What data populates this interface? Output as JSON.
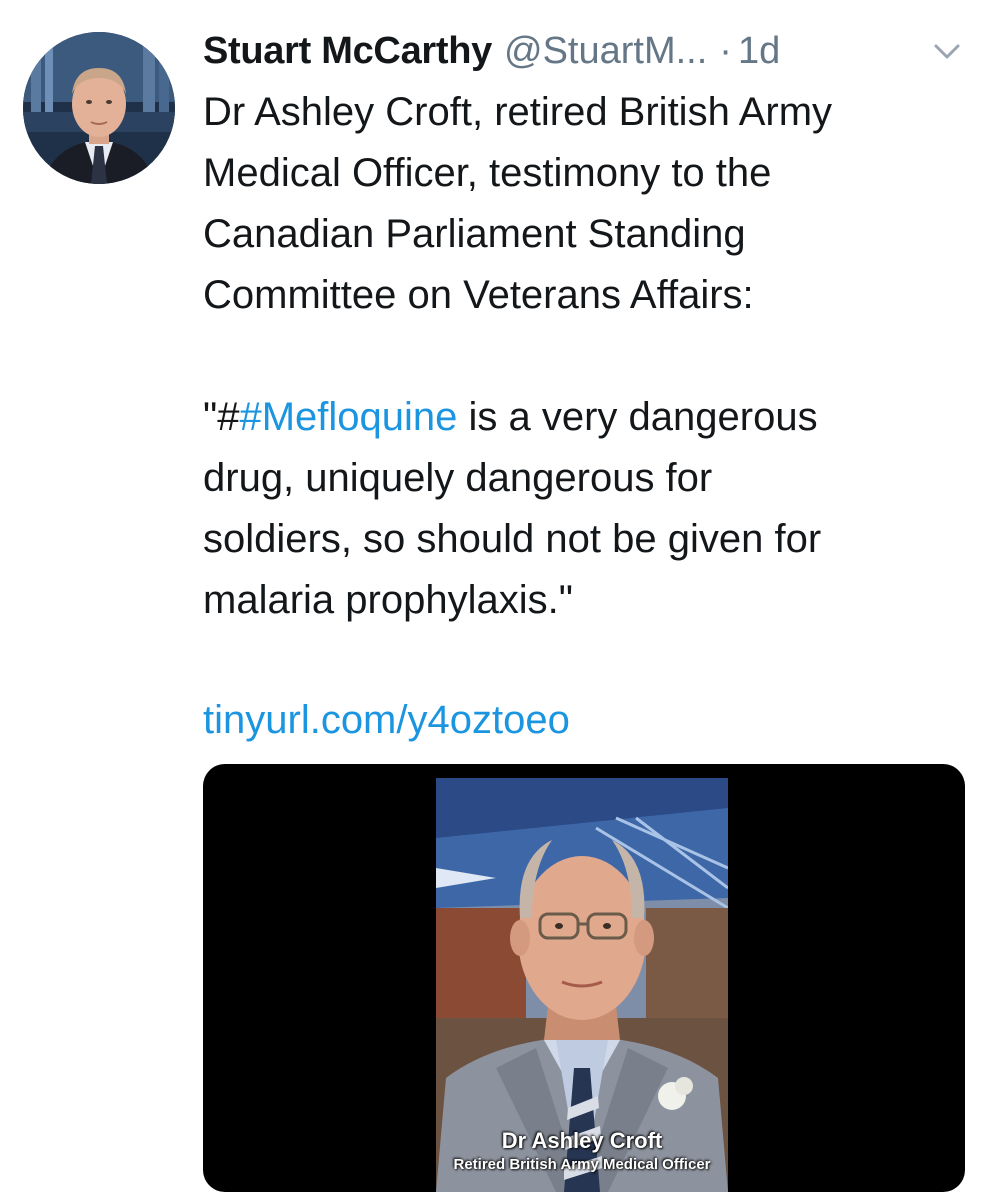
{
  "tweet": {
    "display_name": "Stuart McCarthy",
    "handle": "@StuartM...",
    "separator": "·",
    "time": "1d",
    "text_lines": [
      "Dr Ashley Croft, retired British Army",
      "Medical Officer, testimony to the",
      "Canadian Parliament Standing",
      "Committee on Veterans Affairs:"
    ],
    "quote_open": "\"#",
    "hashtag": "#Mefloquine",
    "quote_rest_line1": " is a very dangerous",
    "quote_lines": [
      "drug, uniquely dangerous for",
      "soldiers, so should not be given for",
      "malaria prophylaxis.\""
    ],
    "link": "tinyurl.com/y4oztoeo"
  },
  "media": {
    "caption_name": "Dr Ashley Croft",
    "caption_title": "Retired British Army Medical Officer"
  },
  "icons": {
    "caret": "chevron-down-icon",
    "avatar": "avatar"
  },
  "colors": {
    "text": "#14171a",
    "muted": "#657786",
    "link": "#1b95e0",
    "media_bg": "#000000"
  }
}
